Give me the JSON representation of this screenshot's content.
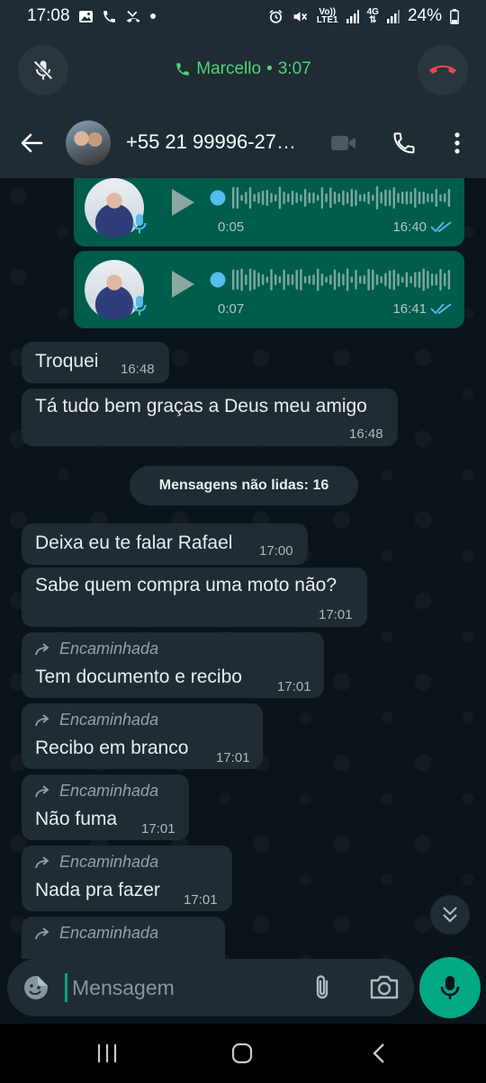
{
  "status_bar": {
    "time": "17:08",
    "battery": "24%",
    "volte_top": "Vo))",
    "volte_bottom": "LTE1",
    "net_type": "4G",
    "icons": [
      "gallery-icon",
      "call-icon",
      "missed-call-icon",
      "dot-icon",
      "alarm-icon",
      "mute-icon",
      "signal-icon",
      "battery-icon"
    ]
  },
  "call_bar": {
    "caller": "Marcello",
    "separator": "•",
    "duration": "3:07",
    "accent": "#52d27c",
    "hangup_color": "#f0444b"
  },
  "header": {
    "contact": "+55 21 99996-27…"
  },
  "messages": {
    "voice1": {
      "duration": "0:05",
      "time": "16:40"
    },
    "voice2": {
      "duration": "0:07",
      "time": "16:41"
    },
    "m1": {
      "text": "Troquei",
      "time": "16:48"
    },
    "m2": {
      "text": "Tá tudo bem graças a Deus meu amigo",
      "time": "16:48"
    },
    "unread": "Mensagens não lidas: 16",
    "m3": {
      "text": "Deixa eu te falar Rafael",
      "time": "17:00"
    },
    "m4": {
      "text": "Sabe quem compra uma moto não?",
      "time": "17:01"
    },
    "forwarded_label": "Encaminhada",
    "m5": {
      "text": "Tem documento e recibo",
      "time": "17:01"
    },
    "m6": {
      "text": "Recibo em branco",
      "time": "17:01"
    },
    "m7": {
      "text": "Não fuma",
      "time": "17:01"
    },
    "m8": {
      "text": "Nada pra fazer",
      "time": "17:01"
    }
  },
  "composer": {
    "placeholder": "Mensagem"
  },
  "colors": {
    "outgoing_bubble": "#005c4b",
    "incoming_bubble": "#1f2c33",
    "accent_green": "#00a884",
    "read_ticks": "#53bdeb"
  }
}
